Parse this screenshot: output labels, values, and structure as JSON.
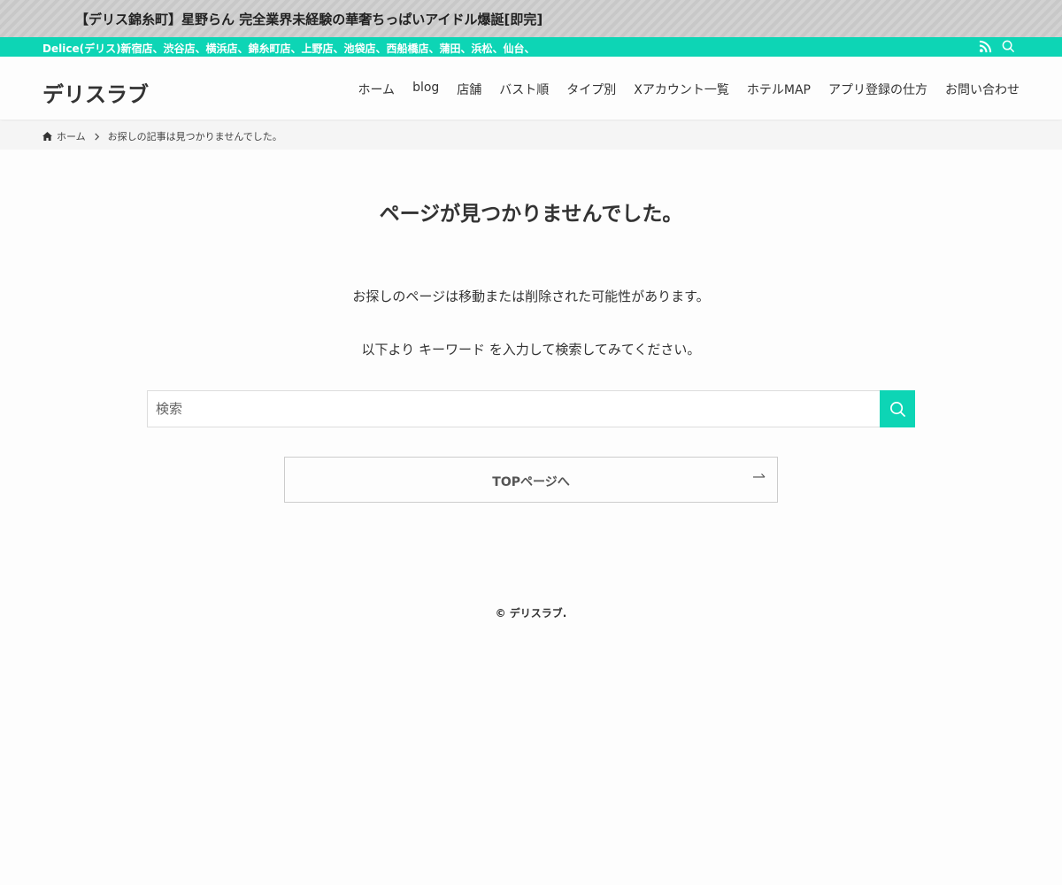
{
  "notice_bar": {
    "text": "【デリス錦糸町】星野らん 完全業界未経験の華奢ちっぱいアイドル爆誕[即完]"
  },
  "info_bar": {
    "text": "Delice(デリス)新宿店、渋谷店、横浜店、錦糸町店、上野店、池袋店、西船橋店、蒲田、浜松、仙台、"
  },
  "header": {
    "logo": "デリスラブ",
    "nav": [
      {
        "label": "ホーム"
      },
      {
        "label": "blog"
      },
      {
        "label": "店舗"
      },
      {
        "label": "バスト順"
      },
      {
        "label": "タイプ別"
      },
      {
        "label": "Xアカウント一覧"
      },
      {
        "label": "ホテルMAP"
      },
      {
        "label": "アプリ登録の仕方"
      },
      {
        "label": "お問い合わせ"
      }
    ]
  },
  "breadcrumb": {
    "home": "ホーム",
    "current": "お探しの記事は見つかりませんでした。"
  },
  "main": {
    "title": "ページが見つかりませんでした。",
    "message1": "お探しのページは移動または削除された可能性があります。",
    "message2": "以下より キーワード を入力して検索してみてください。",
    "search_placeholder": "検索",
    "top_button": "TOPページへ"
  },
  "footer": {
    "copyright": "© デリスラブ."
  },
  "icons": {
    "rss": "rss-icon",
    "search": "search-icon",
    "home": "home-icon",
    "chevron": "chevron-right-icon",
    "arrow": "arrow-right-icon"
  },
  "colors": {
    "accent": "#0dd5b5",
    "notice_bg": "#c8c8c8",
    "text": "#333333",
    "background": "#fdfdfd"
  }
}
